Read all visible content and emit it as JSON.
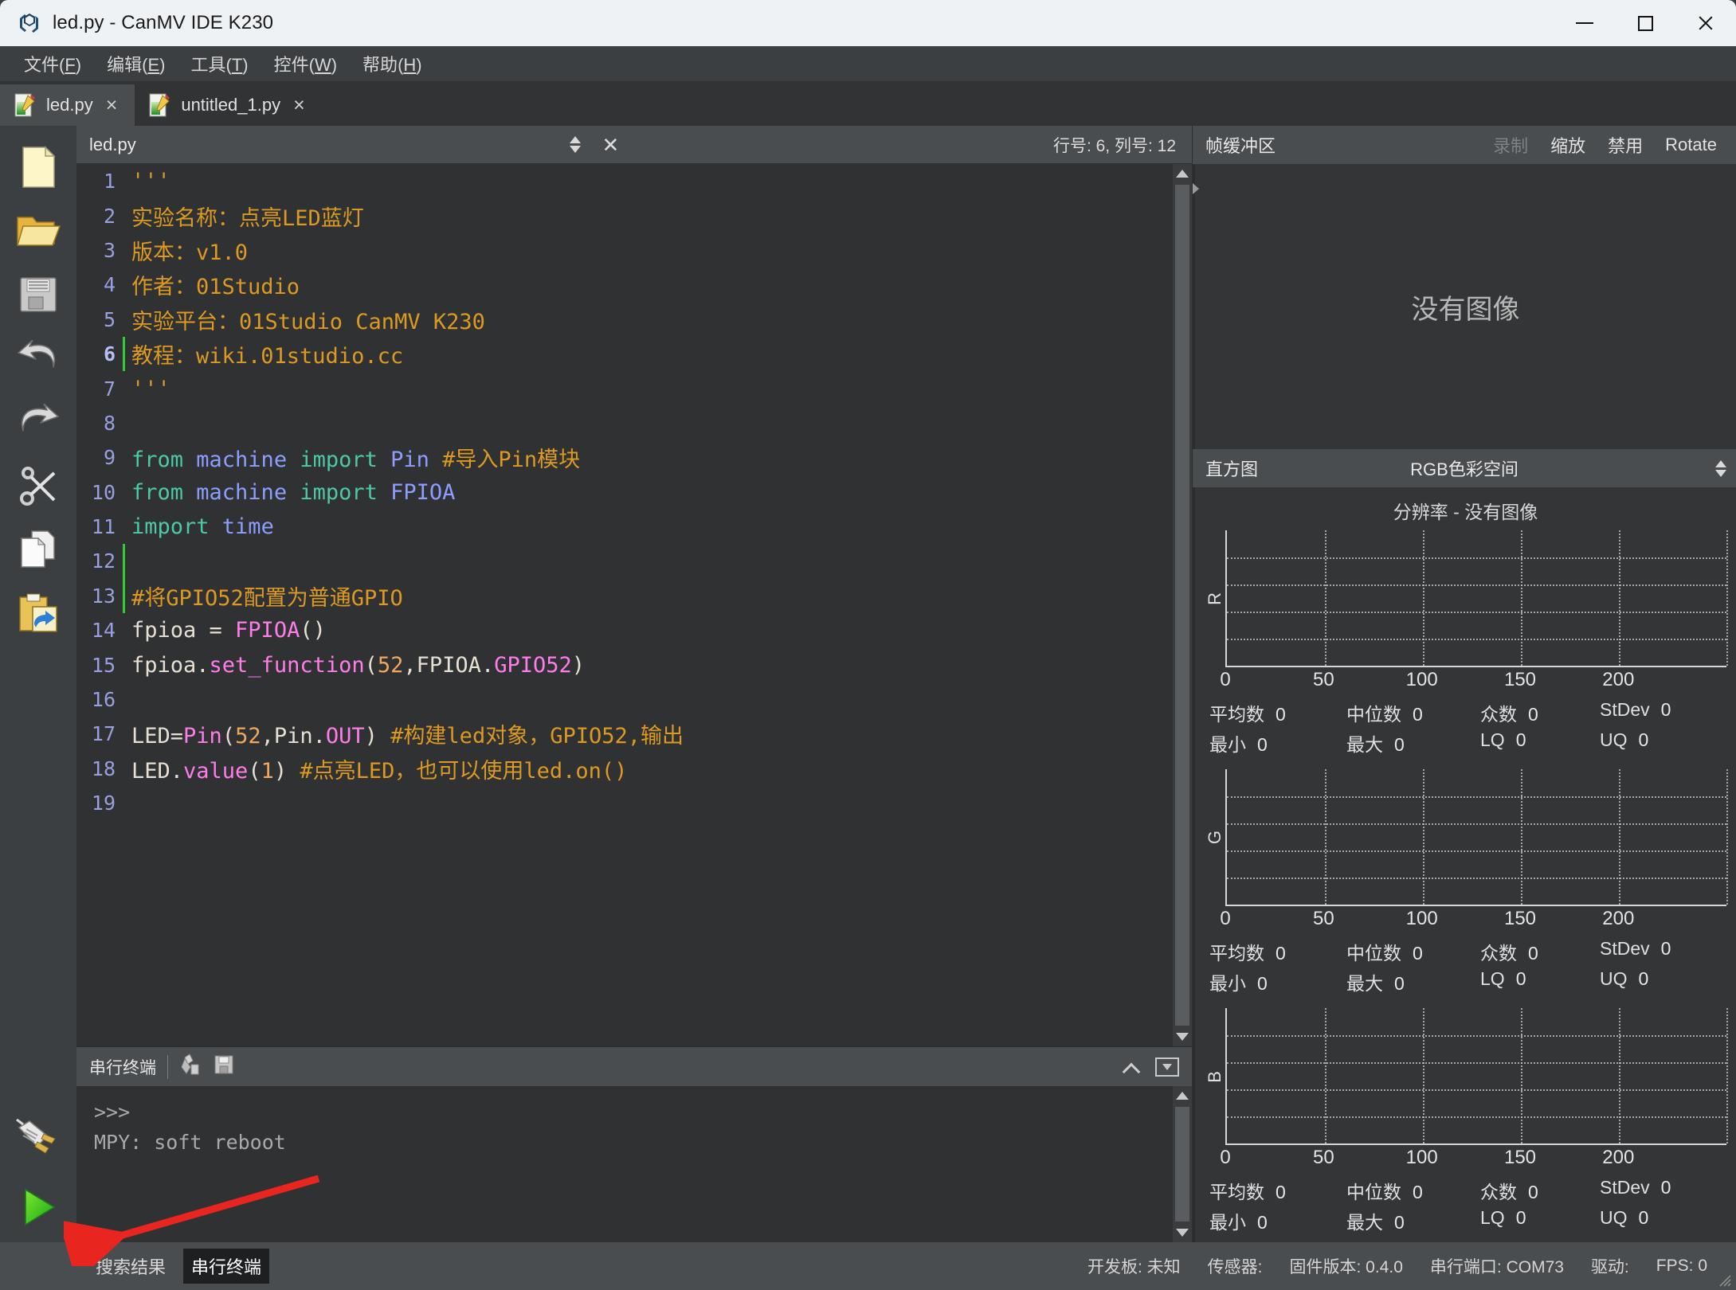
{
  "window": {
    "title": "led.py - CanMV IDE K230",
    "app_icon": "canmv-logo-icon",
    "controls": {
      "minimize": "minimize-icon",
      "maximize": "maximize-icon",
      "close": "close-icon"
    }
  },
  "menubar": [
    {
      "label": "文件(F)",
      "plain": "文件",
      "key": "F"
    },
    {
      "label": "编辑(E)",
      "plain": "编辑",
      "key": "E"
    },
    {
      "label": "工具(T)",
      "plain": "工具",
      "key": "T"
    },
    {
      "label": "控件(W)",
      "plain": "控件",
      "key": "W"
    },
    {
      "label": "帮助(H)",
      "plain": "帮助",
      "key": "H"
    }
  ],
  "file_tabs": [
    {
      "label": "led.py",
      "active": true,
      "close": "×"
    },
    {
      "label": "untitled_1.py",
      "active": false,
      "close": "×"
    }
  ],
  "left_rail": [
    {
      "name": "new-file-icon"
    },
    {
      "name": "open-folder-icon"
    },
    {
      "name": "save-icon"
    },
    {
      "name": "undo-icon"
    },
    {
      "name": "redo-icon"
    },
    {
      "name": "cut-icon"
    },
    {
      "name": "copy-icon"
    },
    {
      "name": "paste-icon"
    }
  ],
  "left_rail_bottom": [
    {
      "name": "connect-plug-icon"
    },
    {
      "name": "run-icon"
    }
  ],
  "editor": {
    "filename": "led.py",
    "close_label": "✕",
    "position": "行号: 6, 列号: 12",
    "cursor_line": 6,
    "lines": [
      {
        "n": "1",
        "guide": false,
        "tokens": [
          {
            "t": "'''",
            "c": "tk-c"
          }
        ]
      },
      {
        "n": "2",
        "guide": false,
        "tokens": [
          {
            "t": "实验名称：点亮LED蓝灯",
            "c": "tk-c"
          }
        ]
      },
      {
        "n": "3",
        "guide": false,
        "tokens": [
          {
            "t": "版本：v1.0",
            "c": "tk-c"
          }
        ]
      },
      {
        "n": "4",
        "guide": false,
        "tokens": [
          {
            "t": "作者：01Studio",
            "c": "tk-c"
          }
        ]
      },
      {
        "n": "5",
        "guide": false,
        "tokens": [
          {
            "t": "实验平台：01Studio CanMV K230",
            "c": "tk-c"
          }
        ]
      },
      {
        "n": "6",
        "guide": true,
        "cur": true,
        "tokens": [
          {
            "t": "教程：wiki.01studio.cc",
            "c": "tk-c"
          }
        ]
      },
      {
        "n": "7",
        "guide": false,
        "tokens": [
          {
            "t": "'''",
            "c": "tk-c"
          }
        ]
      },
      {
        "n": "8",
        "guide": false,
        "tokens": []
      },
      {
        "n": "9",
        "guide": false,
        "tokens": [
          {
            "t": "from ",
            "c": "tk-m"
          },
          {
            "t": "machine ",
            "c": "tk-k"
          },
          {
            "t": "import ",
            "c": "tk-m"
          },
          {
            "t": "Pin ",
            "c": "tk-k"
          },
          {
            "t": "#导入Pin模块",
            "c": "tk-c"
          }
        ]
      },
      {
        "n": "10",
        "guide": false,
        "tokens": [
          {
            "t": "from ",
            "c": "tk-m"
          },
          {
            "t": "machine ",
            "c": "tk-k"
          },
          {
            "t": "import ",
            "c": "tk-m"
          },
          {
            "t": "FPIOA",
            "c": "tk-k"
          }
        ]
      },
      {
        "n": "11",
        "guide": false,
        "tokens": [
          {
            "t": "import ",
            "c": "tk-m"
          },
          {
            "t": "time",
            "c": "tk-k"
          }
        ]
      },
      {
        "n": "12",
        "guide": true,
        "tokens": []
      },
      {
        "n": "13",
        "guide": true,
        "tokens": [
          {
            "t": "#将GPIO52配置为普通GPIO",
            "c": "tk-c"
          }
        ]
      },
      {
        "n": "14",
        "guide": false,
        "tokens": [
          {
            "t": "fpioa = ",
            "c": "tk-p"
          },
          {
            "t": "FPIOA",
            "c": "tk-cls"
          },
          {
            "t": "()",
            "c": "tk-p"
          }
        ]
      },
      {
        "n": "15",
        "guide": false,
        "tokens": [
          {
            "t": "fpioa.",
            "c": "tk-p"
          },
          {
            "t": "set_function",
            "c": "tk-f"
          },
          {
            "t": "(",
            "c": "tk-p"
          },
          {
            "t": "52",
            "c": "tk-n"
          },
          {
            "t": ",FPIOA.",
            "c": "tk-p"
          },
          {
            "t": "GPIO52",
            "c": "tk-f"
          },
          {
            "t": ")",
            "c": "tk-p"
          }
        ]
      },
      {
        "n": "16",
        "guide": false,
        "tokens": []
      },
      {
        "n": "17",
        "guide": false,
        "tokens": [
          {
            "t": "LED=",
            "c": "tk-p"
          },
          {
            "t": "Pin",
            "c": "tk-cls"
          },
          {
            "t": "(",
            "c": "tk-p"
          },
          {
            "t": "52",
            "c": "tk-n"
          },
          {
            "t": ",Pin.",
            "c": "tk-p"
          },
          {
            "t": "OUT",
            "c": "tk-f"
          },
          {
            "t": ") ",
            "c": "tk-p"
          },
          {
            "t": "#构建led对象，GPIO52,输出",
            "c": "tk-c"
          }
        ]
      },
      {
        "n": "18",
        "guide": false,
        "tokens": [
          {
            "t": "LED.",
            "c": "tk-p"
          },
          {
            "t": "value",
            "c": "tk-f"
          },
          {
            "t": "(",
            "c": "tk-p"
          },
          {
            "t": "1",
            "c": "tk-n"
          },
          {
            "t": ") ",
            "c": "tk-p"
          },
          {
            "t": "#点亮LED，也可以使用led.on()",
            "c": "tk-c"
          }
        ]
      },
      {
        "n": "19",
        "guide": false,
        "tokens": []
      }
    ]
  },
  "terminal": {
    "title": "串行终端",
    "clear_icon": "clear-icon",
    "save_icon": "save-log-icon",
    "collapse_icon": "chevron-up-icon",
    "detach_icon": "dropdown-box-icon",
    "lines": [
      ">>>",
      "MPY: soft reboot"
    ]
  },
  "framebuffer": {
    "title": "帧缓冲区",
    "actions": [
      {
        "label": "录制",
        "disabled": true
      },
      {
        "label": "缩放",
        "disabled": false
      },
      {
        "label": "禁用",
        "disabled": false
      },
      {
        "label": "Rotate",
        "disabled": false
      }
    ],
    "empty_text": "没有图像"
  },
  "histogram": {
    "title": "直方图",
    "colorspace": "RGB色彩空间",
    "resolution_text": "分辨率 - 没有图像",
    "stat_labels": {
      "mean": "平均数",
      "median": "中位数",
      "mode": "众数",
      "stdev": "StDev",
      "min": "最小",
      "max": "最大",
      "lq": "LQ",
      "uq": "UQ"
    },
    "channels": [
      {
        "name": "R",
        "mean": "0",
        "median": "0",
        "mode": "0",
        "stdev": "0",
        "min": "0",
        "max": "0",
        "lq": "0",
        "uq": "0"
      },
      {
        "name": "G",
        "mean": "0",
        "median": "0",
        "mode": "0",
        "stdev": "0",
        "min": "0",
        "max": "0",
        "lq": "0",
        "uq": "0"
      },
      {
        "name": "B",
        "mean": "0",
        "median": "0",
        "mode": "0",
        "stdev": "0",
        "min": "0",
        "max": "0",
        "lq": "0",
        "uq": "0"
      }
    ]
  },
  "chart_data": {
    "type": "histogram",
    "title": "分辨率 - 没有图像",
    "xlabel": "",
    "ylabel": "",
    "xticks": [
      0,
      50,
      100,
      150,
      200
    ],
    "xlim": [
      0,
      255
    ],
    "grid": true,
    "legend": false,
    "series": [
      {
        "name": "R",
        "values": []
      },
      {
        "name": "G",
        "values": []
      },
      {
        "name": "B",
        "values": []
      }
    ]
  },
  "statusbar": {
    "tabs": [
      {
        "label": "搜索结果",
        "active": false
      },
      {
        "label": "串行终端",
        "active": true
      }
    ],
    "fields": [
      {
        "label": "开发板:",
        "value": "未知"
      },
      {
        "label": "传感器:",
        "value": ""
      },
      {
        "label": "固件版本:",
        "value": "0.4.0"
      },
      {
        "label": "串行端口:",
        "value": "COM73"
      },
      {
        "label": "驱动:",
        "value": ""
      },
      {
        "label": "FPS:",
        "value": "0"
      }
    ]
  },
  "annotation": {
    "arrow_color": "#e8261f",
    "points_to": "run-icon"
  }
}
